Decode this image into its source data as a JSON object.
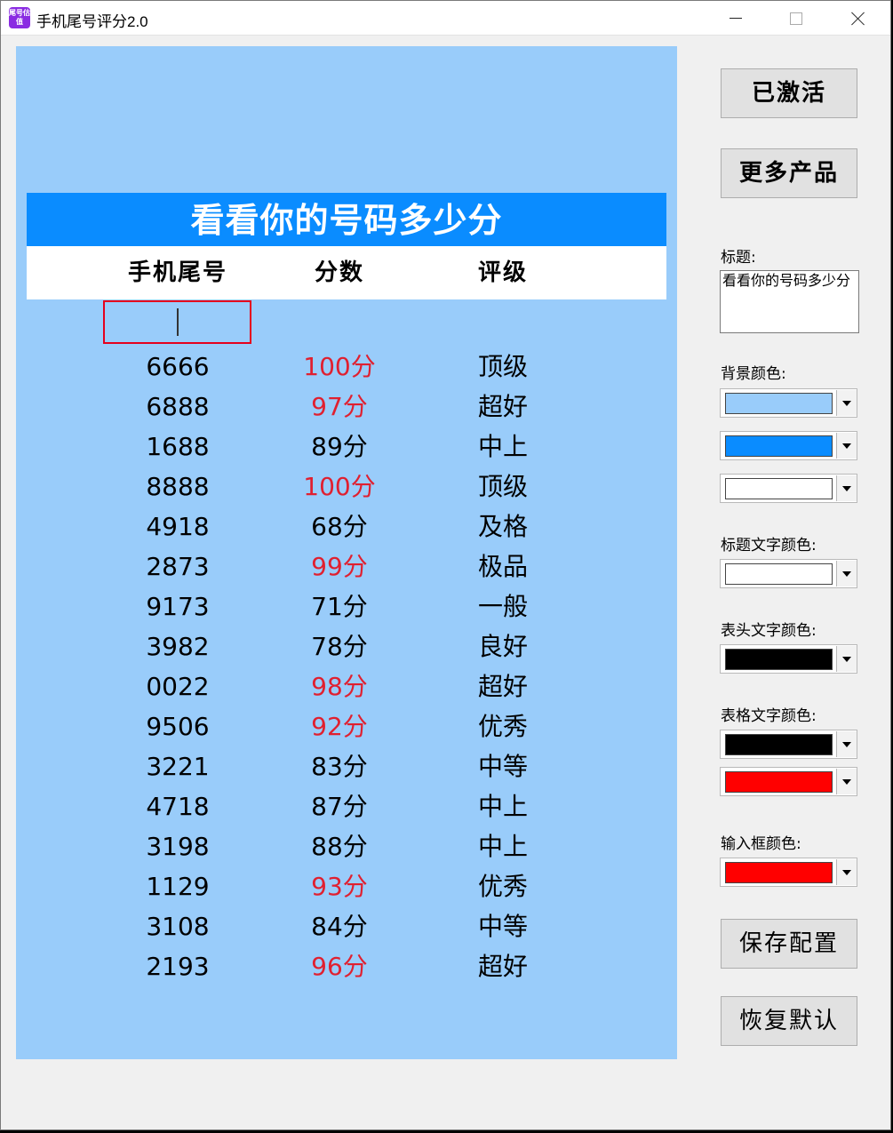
{
  "window": {
    "icon_text": "尾号估值",
    "title": "手机尾号评分2.0"
  },
  "preview": {
    "banner_title": "看看你的号码多少分",
    "headers": [
      "手机尾号",
      "分数",
      "评级"
    ],
    "rows": [
      {
        "number": "6666",
        "score": "100分",
        "grade": "顶级",
        "high": true
      },
      {
        "number": "6888",
        "score": "97分",
        "grade": "超好",
        "high": true
      },
      {
        "number": "1688",
        "score": "89分",
        "grade": "中上",
        "high": false
      },
      {
        "number": "8888",
        "score": "100分",
        "grade": "顶级",
        "high": true
      },
      {
        "number": "4918",
        "score": "68分",
        "grade": "及格",
        "high": false
      },
      {
        "number": "2873",
        "score": "99分",
        "grade": "极品",
        "high": true
      },
      {
        "number": "9173",
        "score": "71分",
        "grade": "一般",
        "high": false
      },
      {
        "number": "3982",
        "score": "78分",
        "grade": "良好",
        "high": false
      },
      {
        "number": "0022",
        "score": "98分",
        "grade": "超好",
        "high": true
      },
      {
        "number": "9506",
        "score": "92分",
        "grade": "优秀",
        "high": true
      },
      {
        "number": "3221",
        "score": "83分",
        "grade": "中等",
        "high": false
      },
      {
        "number": "4718",
        "score": "87分",
        "grade": "中上",
        "high": false
      },
      {
        "number": "3198",
        "score": "88分",
        "grade": "中上",
        "high": false
      },
      {
        "number": "1129",
        "score": "93分",
        "grade": "优秀",
        "high": true
      },
      {
        "number": "3108",
        "score": "84分",
        "grade": "中等",
        "high": false
      },
      {
        "number": "2193",
        "score": "96分",
        "grade": "超好",
        "high": true
      }
    ]
  },
  "side": {
    "activated_label": "已激活",
    "more_products_label": "更多产品",
    "title_label": "标题:",
    "title_value": "看看你的号码多少分",
    "bg_color_label": "背景颜色:",
    "title_text_color_label": "标题文字颜色:",
    "header_text_color_label": "表头文字颜色:",
    "cell_text_color_label": "表格文字颜色:",
    "input_color_label": "输入框颜色:",
    "save_label": "保存配置",
    "restore_label": "恢复默认"
  },
  "colors": {
    "bg1": "#99ccfa",
    "bg2": "#0a8cff",
    "bg3": "#ffffff",
    "title_text": "#ffffff",
    "header_text": "#000000",
    "cell_text": "#000000",
    "cell_text_high": "#ff0000",
    "input_border": "#ff0000"
  }
}
